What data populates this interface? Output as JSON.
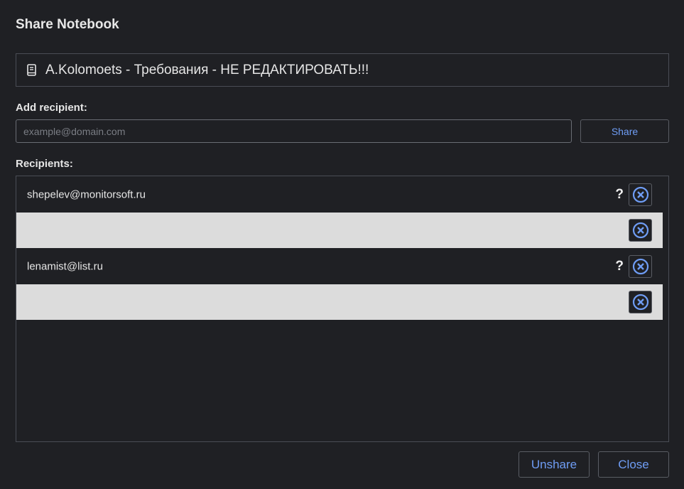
{
  "dialog": {
    "title": "Share Notebook"
  },
  "notebook": {
    "icon": "notebook-icon",
    "name": "A.Kolomoets - Требования - НЕ РЕДАКТИРОВАТЬ!!!"
  },
  "add_recipient": {
    "label": "Add recipient:",
    "input_value": "",
    "placeholder": "example@domain.com",
    "share_label": "Share"
  },
  "recipients": {
    "label": "Recipients:",
    "items": [
      {
        "email": "shepelev@monitorsoft.ru",
        "help": "?",
        "remove_icon": "close-circle-icon"
      },
      {
        "email": "",
        "remove_icon": "close-circle-icon"
      },
      {
        "email": "lenamist@list.ru",
        "help": "?",
        "remove_icon": "close-circle-icon"
      },
      {
        "email": "",
        "remove_icon": "close-circle-icon"
      }
    ]
  },
  "footer": {
    "unshare_label": "Unshare",
    "close_label": "Close"
  },
  "colors": {
    "background": "#1f2024",
    "accent": "#6f9df5",
    "gray_row": "#dcdcdc"
  }
}
